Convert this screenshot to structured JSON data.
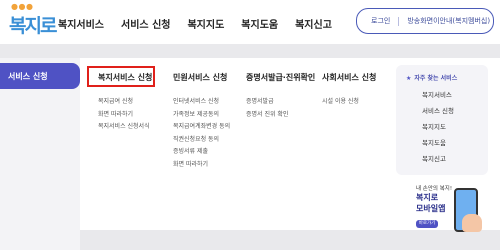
{
  "header": {
    "logo_text": "복지로",
    "nav": [
      "복지서비스",
      "서비스 신청",
      "복지지도",
      "복지도움",
      "복지신고"
    ],
    "util": {
      "login": "로그인",
      "guide": "방송화면이안내(복지멤버십)"
    }
  },
  "sidebar": {
    "active": "서비스 신청"
  },
  "menu": {
    "columns": [
      {
        "title": "복지서비스 신청",
        "items": [
          "복지급여 신청",
          "화면 따라하기",
          "복지서비스 신청서식"
        ]
      },
      {
        "title": "민원서비스 신청",
        "items": [
          "인터넷서비스 신청",
          "가족정보 제공동의",
          "복지급여계좌변경 동의",
          "직권신청요청 동의",
          "증빙서류 제출",
          "화면 따라하기"
        ]
      },
      {
        "title": "증명서발급·진위확인",
        "items": [
          "증명서발급",
          "증명서 진위 확인"
        ]
      },
      {
        "title": "사회서비스 신청",
        "items": [
          "시설 이용 신청"
        ]
      }
    ]
  },
  "often": {
    "title": "자주 찾는 서비스",
    "items": [
      "복지서비스",
      "서비스 신청",
      "복지지도",
      "복지도움",
      "복지신고"
    ]
  },
  "promo": {
    "small": "내 손안의 복지!",
    "line1": "복지로",
    "line2": "모바일앱",
    "button": "바로가기"
  },
  "colors": {
    "accent": "#4f52c4",
    "highlight": "#e0201a"
  }
}
